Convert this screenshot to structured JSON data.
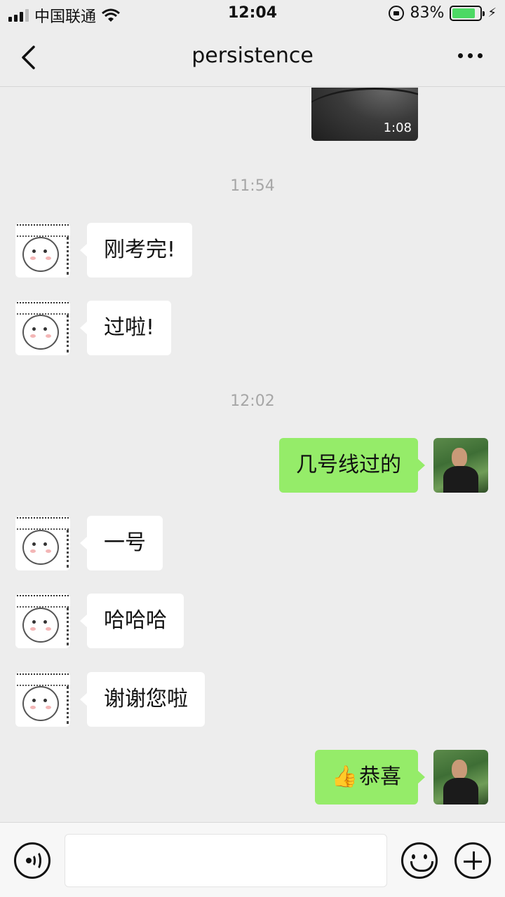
{
  "status_bar": {
    "carrier": "中国联通",
    "time": "12:04",
    "battery_percent": "83%",
    "battery_level": 0.83,
    "icons": [
      "signal-icon",
      "wifi-icon",
      "rotation-lock-icon",
      "battery-icon",
      "charging-bolt-icon"
    ]
  },
  "nav": {
    "title": "persistence",
    "back_icon": "chevron-left-icon",
    "more_icon": "more-dots-icon"
  },
  "chat": {
    "video": {
      "duration": "1:08"
    },
    "timestamps": [
      "11:54",
      "12:02"
    ],
    "messages": [
      {
        "from": "other",
        "text": "刚考完!"
      },
      {
        "from": "other",
        "text": "过啦!"
      },
      {
        "from": "me",
        "text": "几号线过的"
      },
      {
        "from": "other",
        "text": "一号"
      },
      {
        "from": "other",
        "text": "哈哈哈"
      },
      {
        "from": "other",
        "text": "谢谢您啦"
      },
      {
        "from": "me",
        "emoji": "👍",
        "text": "恭喜"
      }
    ]
  },
  "input_bar": {
    "icons": [
      "voice-icon",
      "emoji-icon",
      "plus-icon"
    ]
  },
  "colors": {
    "background": "#ededed",
    "my_bubble": "#95ec69",
    "their_bubble": "#ffffff",
    "timestamp": "#a6a6a6"
  }
}
